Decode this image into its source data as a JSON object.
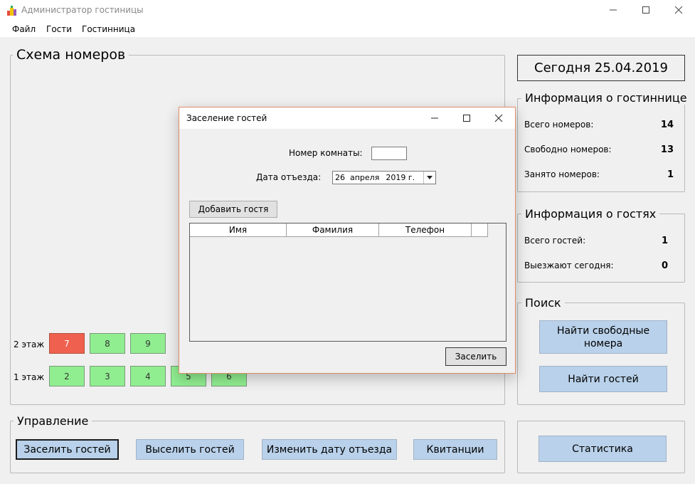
{
  "window": {
    "title": "Администратор гостиницы"
  },
  "menu": [
    "Файл",
    "Гости",
    "Гостинница"
  ],
  "schema": {
    "title": "Схема номеров",
    "floors": [
      {
        "label": "2 этаж",
        "rooms": [
          {
            "number": "7",
            "status": "occupied"
          },
          {
            "number": "8",
            "status": "free"
          },
          {
            "number": "9",
            "status": "free"
          }
        ]
      },
      {
        "label": "1 этаж",
        "rooms": [
          {
            "number": "2",
            "status": "free"
          },
          {
            "number": "3",
            "status": "free"
          },
          {
            "number": "4",
            "status": "free"
          },
          {
            "number": "5",
            "status": "free"
          },
          {
            "number": "6",
            "status": "free"
          }
        ]
      }
    ]
  },
  "today": "Сегодня 25.04.2019",
  "hotel_info": {
    "title": "Информация о гостиннице",
    "total_label": "Всего номеров:",
    "total": "14",
    "free_label": "Свободно номеров:",
    "free": "13",
    "busy_label": "Занято номеров:",
    "busy": "1"
  },
  "guest_info": {
    "title": "Информация о гостях",
    "total_label": "Всего гостей:",
    "total": "1",
    "leaving_label": "Выезжают сегодня:",
    "leaving": "0"
  },
  "search": {
    "title": "Поиск",
    "free_rooms_button": "Найти свободные номера",
    "find_guests_button": "Найти гостей"
  },
  "management": {
    "title": "Управление",
    "checkin_button": "Заселить гостей",
    "checkout_button": "Выселить гостей",
    "change_date_button": "Изменить дату отъезда",
    "receipts_button": "Квитанции"
  },
  "stats_button": "Статистика",
  "dialog": {
    "title": "Заселение гостей",
    "room_label": "Номер комнаты:",
    "room_value": "",
    "date_label": "Дата отъезда:",
    "date_day": "26",
    "date_month": "апреля",
    "date_year": "2019 г.",
    "add_guest_button": "Добавить гостя",
    "columns": [
      "Имя",
      "Фамилия",
      "Телефон"
    ],
    "submit_button": "Заселить"
  },
  "colors": {
    "occupied": "#f0604e",
    "free": "#90ee90",
    "button": "#b9d1ea",
    "dialog_border": "#e08e67"
  },
  "icons": {
    "app": "hotel-app-icon",
    "minimize": "minimize-icon",
    "maximize": "maximize-icon",
    "close": "close-icon",
    "dropdown": "dropdown-arrow-icon"
  }
}
